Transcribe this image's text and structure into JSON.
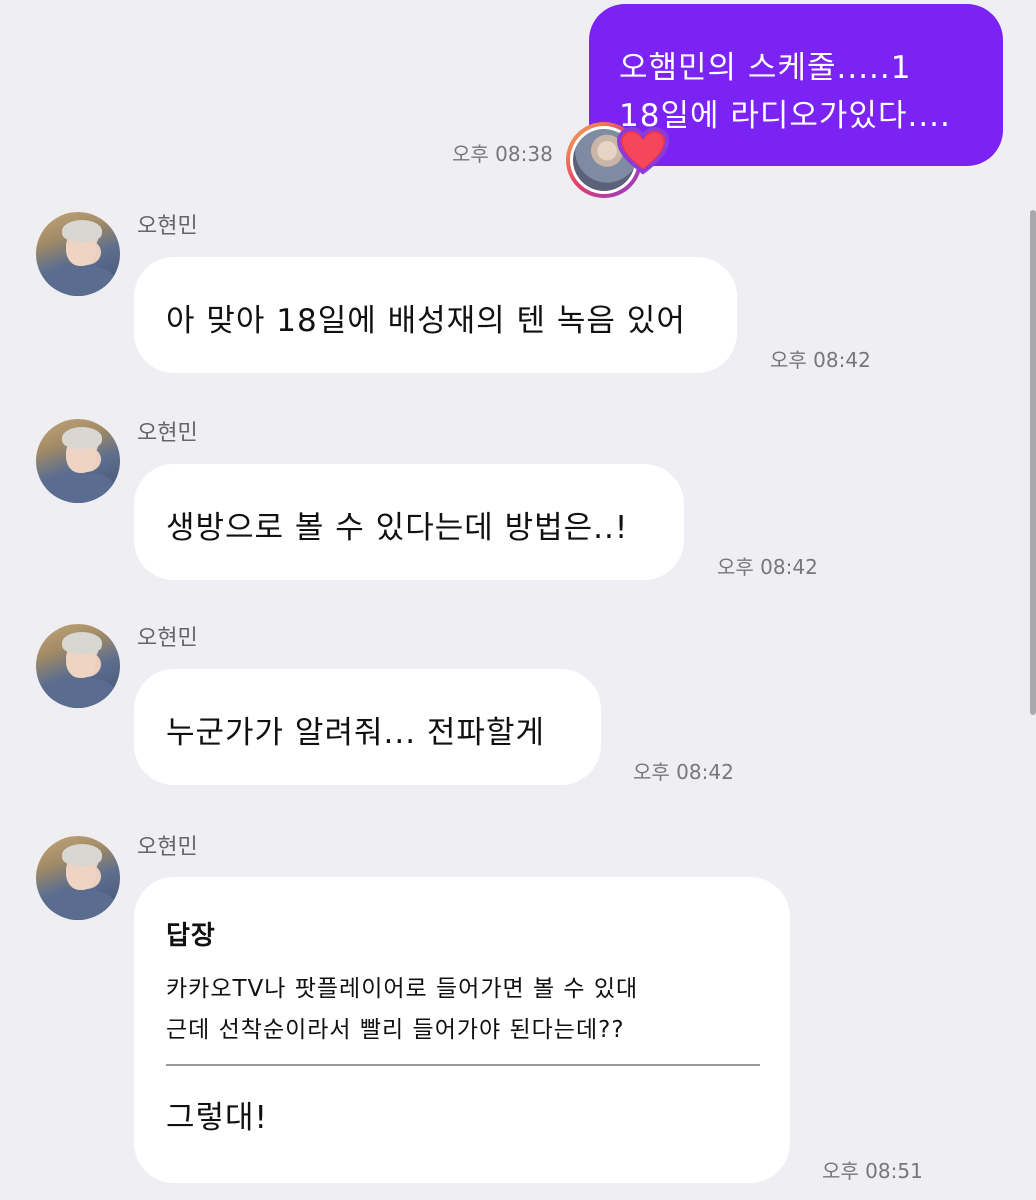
{
  "outgoing": {
    "lines": [
      "오햄민의 스케줄.....1",
      "18일에 라디오가있다...."
    ],
    "time": "오후 08:38",
    "reaction_icon": "heart-icon",
    "color": "#7b22f5"
  },
  "messages": [
    {
      "sender": "오현민",
      "text": "아 맞아 18일에 배성재의 텐 녹음 있어",
      "time": "오후 08:42"
    },
    {
      "sender": "오현민",
      "text": "생방으로 볼 수 있다는데 방법은..!",
      "time": "오후 08:42"
    },
    {
      "sender": "오현민",
      "text": "누군가가 알려줘... 전파할게",
      "time": "오후 08:42"
    },
    {
      "sender": "오현민",
      "reply": {
        "title": "답장",
        "quoted_lines": [
          "카카오TV나 팟플레이어로 들어가면 볼 수 있대",
          "근데 선착순이라서 빨리 들어가야 된다는데??"
        ],
        "answer": "그렇대!"
      },
      "time": "오후 08:51"
    }
  ]
}
